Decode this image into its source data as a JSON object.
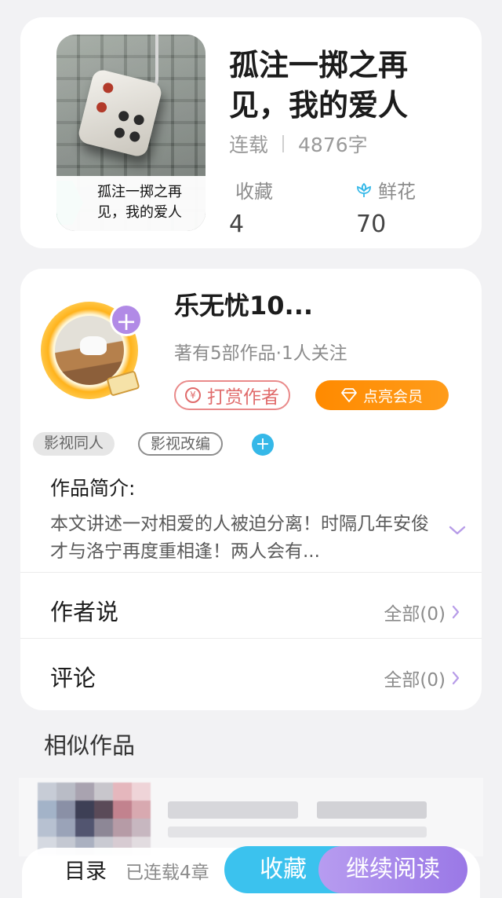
{
  "book": {
    "cover_caption": "孤注一掷之再见，我的爱人",
    "title": "孤注一掷之再见，我的爱人",
    "status": "连载",
    "word_count": "4876字",
    "favorites_label": "收藏",
    "favorites_count": "4",
    "flowers_label": "鲜花",
    "flowers_count": "70"
  },
  "author": {
    "name": "乐无忧10...",
    "meta": "著有5部作品·1人关注",
    "tip_label": "打赏作者",
    "tip_icon": "¥",
    "vip_label": "点亮会员",
    "follow_icon": "+"
  },
  "tags": [
    {
      "label": "影视同人"
    },
    {
      "label": "影视改编"
    }
  ],
  "tag_add_icon": "+",
  "intro": {
    "title": "作品简介:",
    "text": "本文讲述一对相爱的人被迫分离！时隔几年安俊才与洛宁再度重相逢！两人会有..."
  },
  "author_says": {
    "label": "作者说",
    "link": "全部(0)"
  },
  "comments": {
    "label": "评论",
    "link": "全部(0)"
  },
  "similar": {
    "title": "相似作品"
  },
  "bottom_bar": {
    "catalog": "目录",
    "chapters": "已连载4章",
    "collect": "收藏",
    "continue": "继续阅读"
  },
  "colors": {
    "accent_purple": "#b18ae6",
    "accent_blue": "#3bc2ee",
    "vip_orange": "#ff8a00",
    "tip_red": "#e06b6b"
  }
}
